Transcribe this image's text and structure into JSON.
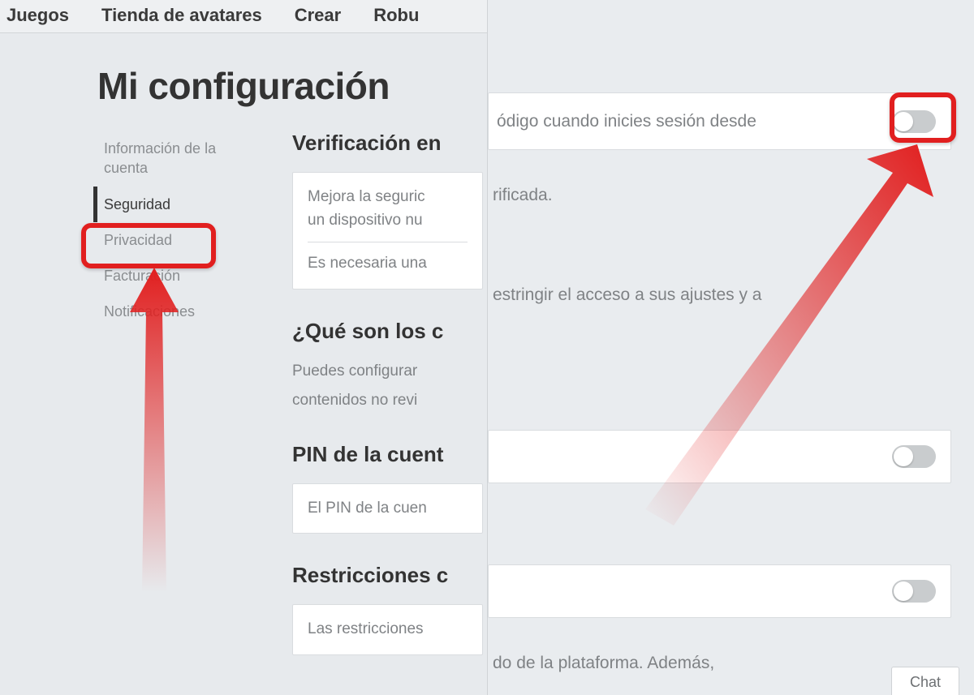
{
  "nav": {
    "items": [
      "Juegos",
      "Tienda de avatares",
      "Crear",
      "Robu"
    ]
  },
  "page_title": "Mi configuración",
  "sidebar": {
    "items": [
      {
        "label": "Información de la cuenta"
      },
      {
        "label": "Seguridad"
      },
      {
        "label": "Privacidad"
      },
      {
        "label": "Facturación"
      },
      {
        "label": "Notificaciones"
      }
    ],
    "active_index": 1
  },
  "sections": {
    "verify_h": "Verificación en",
    "verify_line1": "Mejora la seguric",
    "verify_line2": "un dispositivo nu",
    "verify_req": "Es necesaria una",
    "what_h": "¿Qué son los c",
    "what_line1": "Puedes configurar",
    "what_line2": "contenidos no revi",
    "pin_h": "PIN de la cuent",
    "pin_line": "El PIN de la cuen",
    "restr_h": "Restricciones c",
    "restr_line": "Las restricciones"
  },
  "right": {
    "row1_text": "ódigo cuando inicies sesión desde",
    "float1": "rificada.",
    "float2": "estringir el acceso a sus ajustes y a",
    "float3": "do de la plataforma. Además,"
  },
  "chat_label": "Chat"
}
